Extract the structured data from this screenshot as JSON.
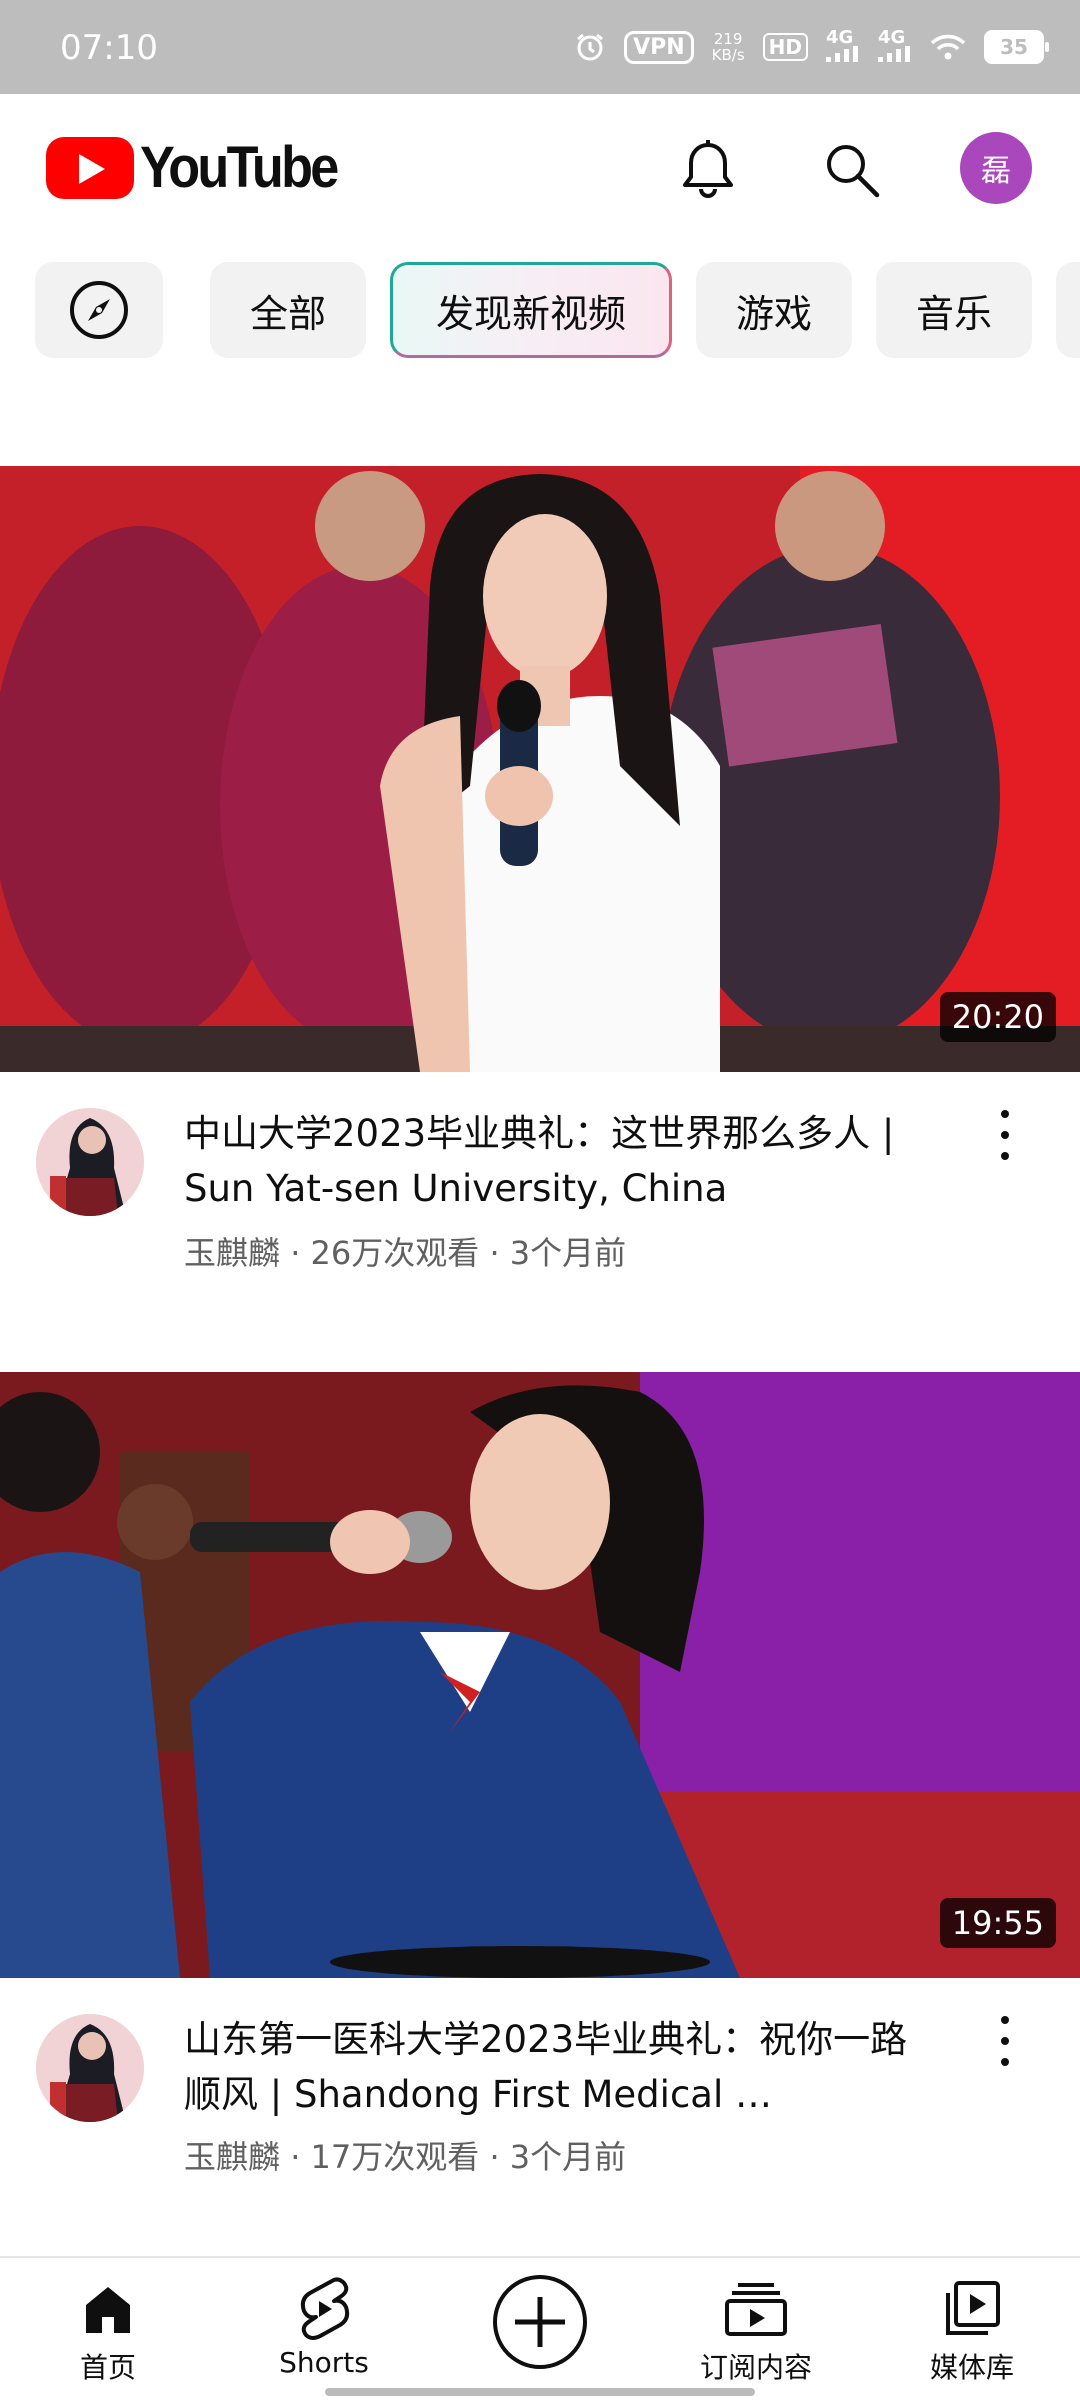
{
  "status_bar": {
    "time": "07:10",
    "vpn": "VPN",
    "speed_value": "219",
    "speed_unit": "KB/s",
    "hd": "HD",
    "net1": "4G",
    "net2": "4G",
    "battery": "35",
    "icons": [
      "alarm-icon",
      "wifi-icon",
      "battery-icon"
    ]
  },
  "header": {
    "logo_text": "YouTube",
    "avatar_letter": "磊",
    "icons": [
      "notifications-bell-icon",
      "search-icon"
    ],
    "colors": {
      "brand_red": "#ff0000",
      "avatar": "#ab47bc"
    }
  },
  "chips": {
    "explore_icon": "compass-icon",
    "items": [
      "全部",
      "发现新视频",
      "游戏",
      "音乐"
    ],
    "active_index": 1
  },
  "videos": [
    {
      "title": "中山大学2023毕业典礼：这世界那么多人 | Sun Yat-sen University, China",
      "channel": "玉麒麟",
      "views": "26万次观看",
      "age": "3个月前",
      "duration": "20:20"
    },
    {
      "title": "山东第一医科大学2023毕业典礼：祝你一路顺风 | Shandong First Medical …",
      "channel": "玉麒麟",
      "views": "17万次观看",
      "age": "3个月前",
      "duration": "19:55"
    }
  ],
  "meta_separator": "·",
  "bottom_nav": {
    "items": [
      {
        "label": "首页",
        "icon": "home-icon"
      },
      {
        "label": "Shorts",
        "icon": "shorts-icon"
      },
      {
        "label": "",
        "icon": "create-plus-icon"
      },
      {
        "label": "订阅内容",
        "icon": "subscriptions-icon"
      },
      {
        "label": "媒体库",
        "icon": "library-icon"
      }
    ]
  }
}
